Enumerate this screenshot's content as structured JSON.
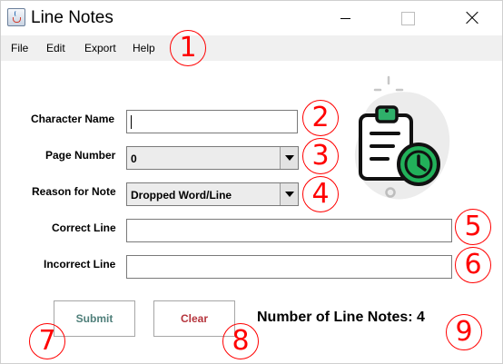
{
  "window": {
    "title": "Line Notes",
    "icon": "java-cup-icon",
    "controls": [
      "minimize-icon",
      "maximize-icon",
      "close-icon"
    ]
  },
  "menu": {
    "items": [
      "File",
      "Edit",
      "Export",
      "Help"
    ]
  },
  "form": {
    "character_name": {
      "label": "Character Name",
      "value": ""
    },
    "page_number": {
      "label": "Page Number",
      "value": "0"
    },
    "reason": {
      "label": "Reason for Note",
      "value": "Dropped Word/Line"
    },
    "correct_line": {
      "label": "Correct Line",
      "value": ""
    },
    "incorrect_line": {
      "label": "Incorrect Line",
      "value": ""
    }
  },
  "buttons": {
    "submit": "Submit",
    "clear": "Clear"
  },
  "status": {
    "count_label": "Number of Line Notes: 4"
  },
  "illustration": "clipboard-clock-icon",
  "annotations": [
    "1",
    "2",
    "3",
    "4",
    "5",
    "6",
    "7",
    "8",
    "9"
  ],
  "colors": {
    "submit_text": "#4f7f7a",
    "clear_text": "#b5343c",
    "annotation": "#ff0000",
    "clock_green": "#22b15a",
    "clip_green": "#2fb06a"
  }
}
